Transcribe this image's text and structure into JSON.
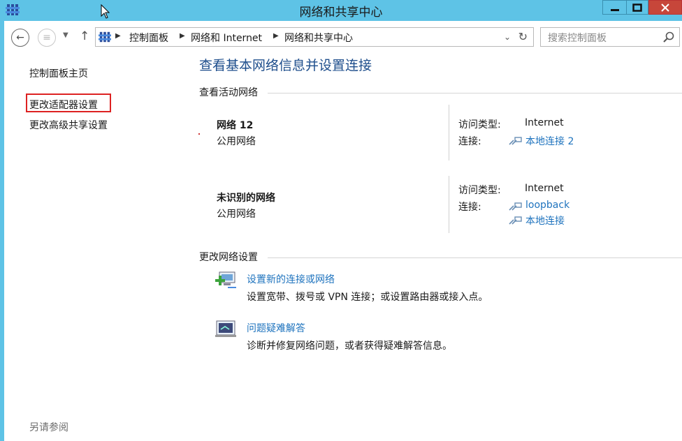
{
  "window": {
    "title": "网络和共享中心"
  },
  "address_bar": {
    "breadcrumbs": [
      "控制面板",
      "网络和 Internet",
      "网络和共享中心"
    ]
  },
  "search": {
    "placeholder": "搜索控制面板"
  },
  "left_pane": {
    "links": [
      "控制面板主页",
      "更改适配器设置",
      "更改高级共享设置"
    ],
    "see_also": "另请参阅"
  },
  "main": {
    "title": "查看基本网络信息并设置连接",
    "active_networks_heading": "查看活动网络",
    "networks": [
      {
        "name": "网络  12",
        "type": "公用网络",
        "access_label": "访问类型:",
        "access_value": "Internet",
        "connections_label": "连接:",
        "connections": [
          "本地连接 2"
        ]
      },
      {
        "name": "未识别的网络",
        "type": "公用网络",
        "access_label": "访问类型:",
        "access_value": "Internet",
        "connections_label": "连接:",
        "connections": [
          "loopback",
          "本地连接"
        ]
      }
    ],
    "change_settings_heading": "更改网络设置",
    "tasks": [
      {
        "title": "设置新的连接或网络",
        "description": "设置宽带、拨号或 VPN 连接；或设置路由器或接入点。",
        "icon": "network-setup-icon"
      },
      {
        "title": "问题疑难解答",
        "description": "诊断并修复网络问题，或者获得疑难解答信息。",
        "icon": "troubleshoot-icon"
      }
    ]
  },
  "colors": {
    "titlebar": "#5ec3e6",
    "link": "#1e73be",
    "heading": "#1e4e8c",
    "highlight_box": "#dd2222",
    "close_button": "#c7463a"
  }
}
